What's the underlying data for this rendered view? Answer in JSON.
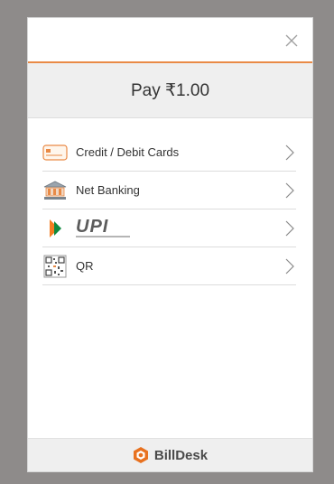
{
  "header": {
    "close_icon": "close-icon"
  },
  "payment": {
    "title": "Pay ₹1.00"
  },
  "methods": [
    {
      "label": "Credit / Debit Cards",
      "icon": "card-icon"
    },
    {
      "label": "Net Banking",
      "icon": "bank-icon"
    },
    {
      "label": "UPI",
      "icon": "upi-logo"
    },
    {
      "label": "QR",
      "icon": "qr-code-icon"
    }
  ],
  "footer": {
    "brand": "BillDesk",
    "brand_color": "#e8711f"
  },
  "colors": {
    "accent": "#e98a46",
    "upi_orange": "#f47c20",
    "upi_green": "#0f8a3e"
  }
}
